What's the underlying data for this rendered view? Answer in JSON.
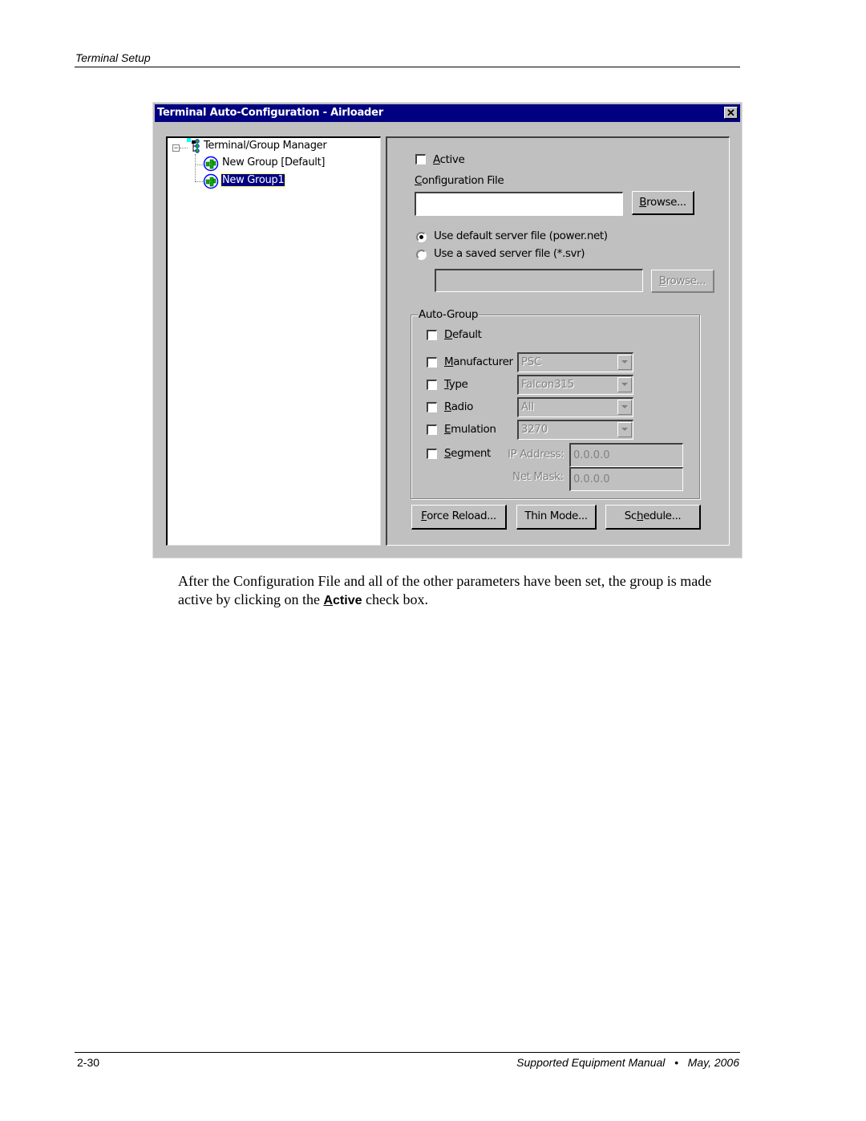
{
  "page": {
    "running_header": "Terminal Setup",
    "page_number": "2-30",
    "footer_title": "Supported Equipment Manual",
    "footer_separator": "•",
    "footer_date": "May, 2006"
  },
  "dialog": {
    "title": "Terminal Auto-Configuration - Airloader",
    "close_label": "✕",
    "tree": {
      "root": {
        "label": "Terminal/Group Manager",
        "expanded": true,
        "expander": "−"
      },
      "children": [
        {
          "label": "New Group [Default]",
          "selected": false
        },
        {
          "label": "New Group1",
          "selected": true
        }
      ]
    },
    "active": {
      "label_mnemonic": "A",
      "label_rest": "ctive",
      "checked": false
    },
    "config_file": {
      "label_mnemonic": "C",
      "label_rest": "onfiguration File",
      "value": "",
      "browse_mnemonic": "B",
      "browse_rest": "rowse..."
    },
    "server_file": {
      "options": [
        {
          "label": "Use default server file (power.net)",
          "selected": true
        },
        {
          "label": "Use a saved server file (*.svr)",
          "selected": false
        }
      ],
      "saved_file_value": "",
      "browse_mnemonic": "B",
      "browse_rest": "rowse...",
      "browse_enabled": false
    },
    "auto_group": {
      "title": "Auto-Group",
      "default": {
        "mnemonic": "D",
        "rest": "efault",
        "checked": false
      },
      "manufacturer": {
        "mnemonic": "M",
        "rest": "anufacturer",
        "checked": false,
        "value": "PSC"
      },
      "type": {
        "mnemonic": "T",
        "rest": "ype",
        "checked": false,
        "value": "Falcon315"
      },
      "radio": {
        "mnemonic": "R",
        "rest": "adio",
        "checked": false,
        "value": "All"
      },
      "emulation": {
        "mnemonic": "E",
        "rest": "mulation",
        "checked": false,
        "value": "3270"
      },
      "segment": {
        "mnemonic": "S",
        "rest": "egment",
        "checked": false
      },
      "ip_address": {
        "label": "IP Address:",
        "value": "0.0.0.0"
      },
      "net_mask": {
        "label": "Net Mask:",
        "value": "0.0.0.0"
      }
    },
    "buttons": {
      "force_reload": {
        "mnemonic": "F",
        "rest": "orce Reload..."
      },
      "thin_mode": {
        "label": "Thin Mode..."
      },
      "schedule": {
        "pre": "Sc",
        "mnemonic": "h",
        "rest": "edule..."
      }
    }
  },
  "body": {
    "text_before": "After the Configuration File and all of the other parameters have been set, the group is made active by clicking on the ",
    "active_mnemonic": "A",
    "active_rest": "ctive",
    "text_after": " check box."
  },
  "colors": {
    "titlebar": "#000080",
    "dialog_face": "#c0c0c0",
    "selection": "#000080"
  }
}
